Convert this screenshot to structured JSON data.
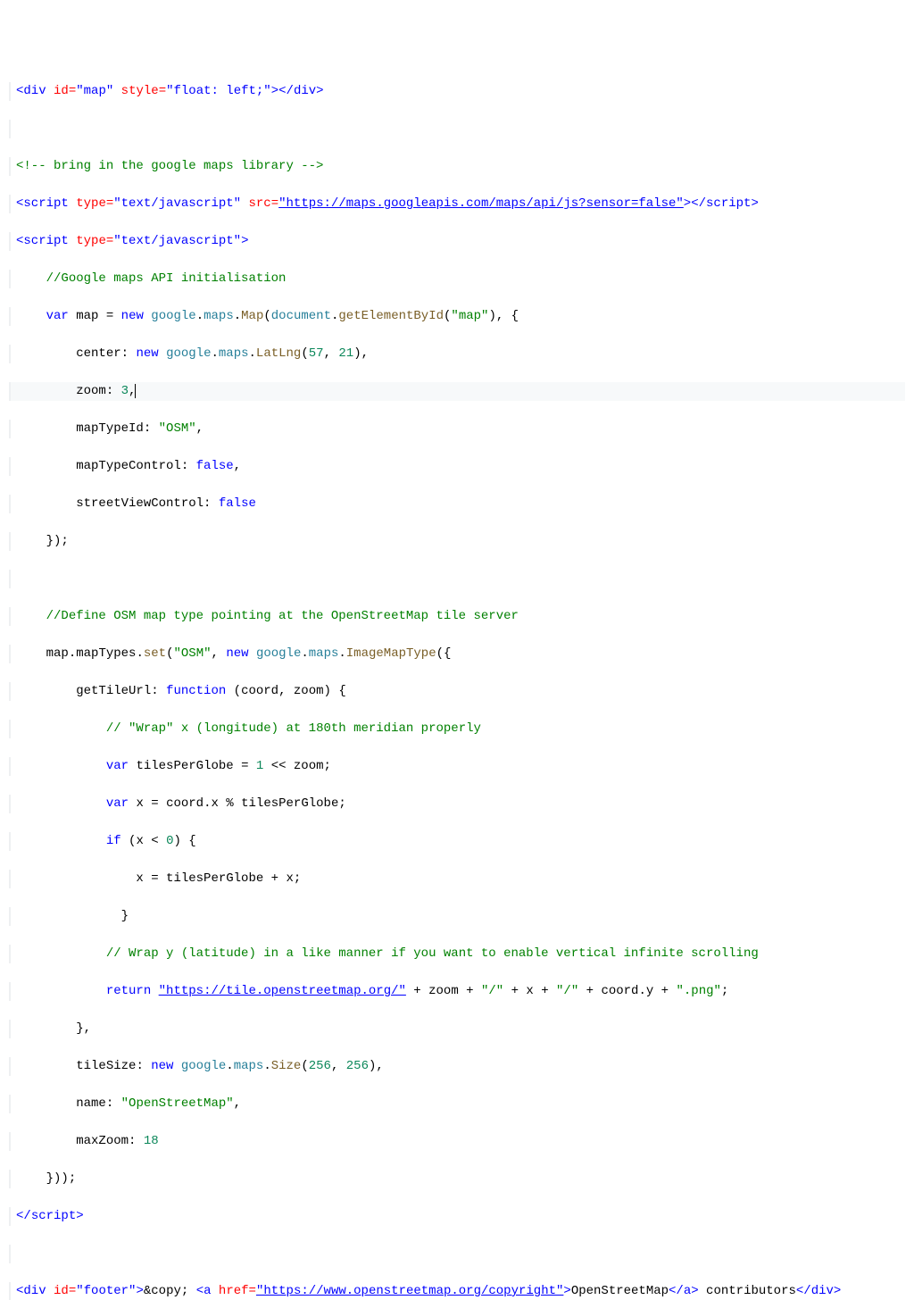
{
  "lines": {
    "l1": {
      "tag_open": "div",
      "attr_id": "id",
      "id_val": "\"map\"",
      "attr_style": "style",
      "style_val": "\"float: left;\"",
      "tag_close": "div"
    },
    "l3_comment": "<!-- bring in the google maps library -->",
    "l4": {
      "tag": "script",
      "attr_type": "type",
      "type_val": "\"text/javascript\"",
      "attr_src": "src",
      "src_val": "\"https://maps.googleapis.com/maps/api/js?sensor=false\"",
      "tag_close": "script"
    },
    "l5": {
      "tag": "script",
      "attr_type": "type",
      "type_val": "\"text/javascript\""
    },
    "l6_comment": "//Google maps API initialisation",
    "l7": {
      "kw_var": "var",
      "name_map": "map",
      "kw_new": "new",
      "ns_google": "google",
      "ns_maps": "maps",
      "fn_Map": "Map",
      "ns_document": "document",
      "fn_getElementById": "getElementById",
      "str_map": "\"map\""
    },
    "l8": {
      "prop_center": "center",
      "kw_new": "new",
      "ns_google": "google",
      "ns_maps": "maps",
      "fn_LatLng": "LatLng",
      "num57": "57",
      "num21": "21"
    },
    "l9": {
      "prop_zoom": "zoom",
      "num3": "3"
    },
    "l10": {
      "prop_mapTypeId": "mapTypeId",
      "str_OSM": "\"OSM\""
    },
    "l11": {
      "prop_mapTypeControl": "mapTypeControl",
      "bool_false": "false"
    },
    "l12": {
      "prop_streetViewControl": "streetViewControl",
      "bool_false": "false"
    },
    "l13_close": "});",
    "l15_comment": "//Define OSM map type pointing at the OpenStreetMap tile server",
    "l16": {
      "name_map": "map",
      "prop_mapTypes": "mapTypes",
      "fn_set": "set",
      "str_OSM": "\"OSM\"",
      "kw_new": "new",
      "ns_google": "google",
      "ns_maps": "maps",
      "fn_ImageMapType": "ImageMapType"
    },
    "l17": {
      "prop_getTileUrl": "getTileUrl",
      "kw_function": "function",
      "arg_coord": "coord",
      "arg_zoom": "zoom"
    },
    "l18_comment": "// \"Wrap\" x (longitude) at 180th meridian properly",
    "l19": {
      "kw_var": "var",
      "name_tilesPerGlobe": "tilesPerGlobe",
      "num1": "1",
      "name_zoom": "zoom"
    },
    "l20": {
      "kw_var": "var",
      "name_x": "x",
      "name_coord": "coord",
      "prop_x": "x",
      "name_tilesPerGlobe": "tilesPerGlobe"
    },
    "l21": {
      "kw_if": "if",
      "name_x": "x",
      "num0": "0"
    },
    "l22": {
      "name_x": "x",
      "name_tilesPerGlobe": "tilesPerGlobe",
      "name_x2": "x"
    },
    "l23_close": "}",
    "l24_comment": "// Wrap y (latitude) in a like manner if you want to enable vertical infinite scrolling",
    "l25": {
      "kw_return": "return",
      "str_url": "\"https://tile.openstreetmap.org/\"",
      "name_zoom": "zoom",
      "str_slash1": "\"/\"",
      "name_x": "x",
      "str_slash2": "\"/\"",
      "name_coord": "coord",
      "prop_y": "y",
      "str_png": "\".png\""
    },
    "l26_close": "},",
    "l27": {
      "prop_tileSize": "tileSize",
      "kw_new": "new",
      "ns_google": "google",
      "ns_maps": "maps",
      "fn_Size": "Size",
      "num256a": "256",
      "num256b": "256"
    },
    "l28": {
      "prop_name": "name",
      "str_OpenStreetMap": "\"OpenStreetMap\""
    },
    "l29": {
      "prop_maxZoom": "maxZoom",
      "num18": "18"
    },
    "l30_close": "}));",
    "l31_close_script": "script",
    "l33": {
      "tag_div": "div",
      "attr_id": "id",
      "id_val": "\"footer\"",
      "entity_copy": "&copy;",
      "tag_a": "a",
      "attr_href": "href",
      "href_val": "\"https://www.openstreetmap.org/copyright\"",
      "link_text": "OpenStreetMap",
      "tag_a_close": "a",
      "trailing": " contributors",
      "tag_div_close": "div"
    }
  }
}
